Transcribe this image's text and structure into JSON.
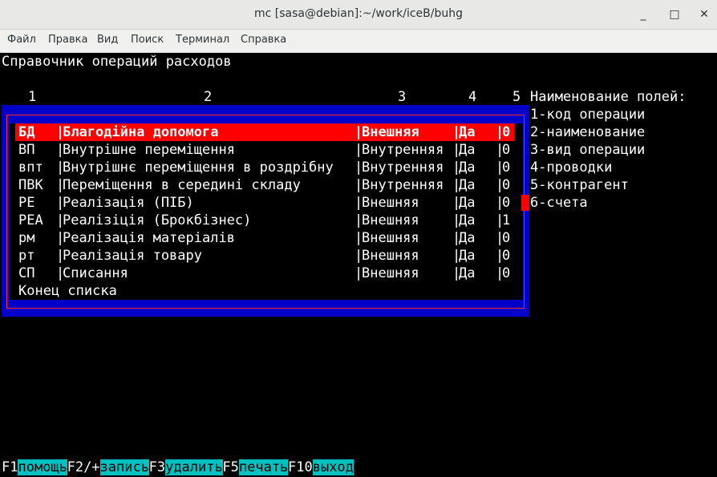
{
  "window": {
    "title": "mc [sasa@debian]:~/work/iceB/buhg",
    "minimize_glyph": "_",
    "maximize_glyph": "□",
    "close_glyph": "✕"
  },
  "menu": [
    "Файл",
    "Правка",
    "Вид",
    "Поиск",
    "Терминал",
    "Справка"
  ],
  "screen_title": "Справочник операций расходов",
  "column_numbers": [
    "1",
    "2",
    "3",
    "4",
    "5"
  ],
  "legend": {
    "header": "Наименование полей:",
    "items": [
      "1-код операции",
      "2-наименование",
      "3-вид операции",
      "4-проводки",
      "5-контрагент",
      "6-счета"
    ]
  },
  "rows": [
    {
      "code": "БД",
      "name": "Благодійна допомога",
      "type": "Внешняя",
      "posting": "Да",
      "contractor": "0"
    },
    {
      "code": "ВП",
      "name": "Внутрішне переміщення",
      "type": "Внутренняя",
      "posting": "Да",
      "contractor": "0"
    },
    {
      "code": "впт",
      "name": "Внутрішнє переміщення в роздрібну",
      "type": "Внутренняя",
      "posting": "Да",
      "contractor": "0"
    },
    {
      "code": "ПВК",
      "name": "Переміщення в середині складу",
      "type": "Внутренняя",
      "posting": "Да",
      "contractor": "0"
    },
    {
      "code": "РЕ",
      "name": "Реалізація (ПІБ)",
      "type": "Внешняя",
      "posting": "Да",
      "contractor": "0"
    },
    {
      "code": "РЕА",
      "name": "Реалізіція (Брокбізнес)",
      "type": "Внешняя",
      "posting": "Да",
      "contractor": "1"
    },
    {
      "code": "рм",
      "name": "Реалізація матеріалів",
      "type": "Внешняя",
      "posting": "Да",
      "contractor": "0"
    },
    {
      "code": "рт",
      "name": "Реалізація товару",
      "type": "Внешняя",
      "posting": "Да",
      "contractor": "0"
    },
    {
      "code": "СП",
      "name": "Списання",
      "type": "Внешняя",
      "posting": "Да",
      "contractor": "0"
    }
  ],
  "separator": "|",
  "end_of_list": "Конец списка",
  "fkeys": [
    {
      "key": "F1",
      "label": "помощь"
    },
    {
      "key": "F2/+",
      "label": "запись"
    },
    {
      "key": "F3",
      "label": "удалить"
    },
    {
      "key": "F5",
      "label": "печать"
    },
    {
      "key": "F10",
      "label": "выход"
    }
  ],
  "colors": {
    "selection": "#ff0000",
    "frame": "#0000c8",
    "fkey_label_bg": "#00c0c0"
  }
}
